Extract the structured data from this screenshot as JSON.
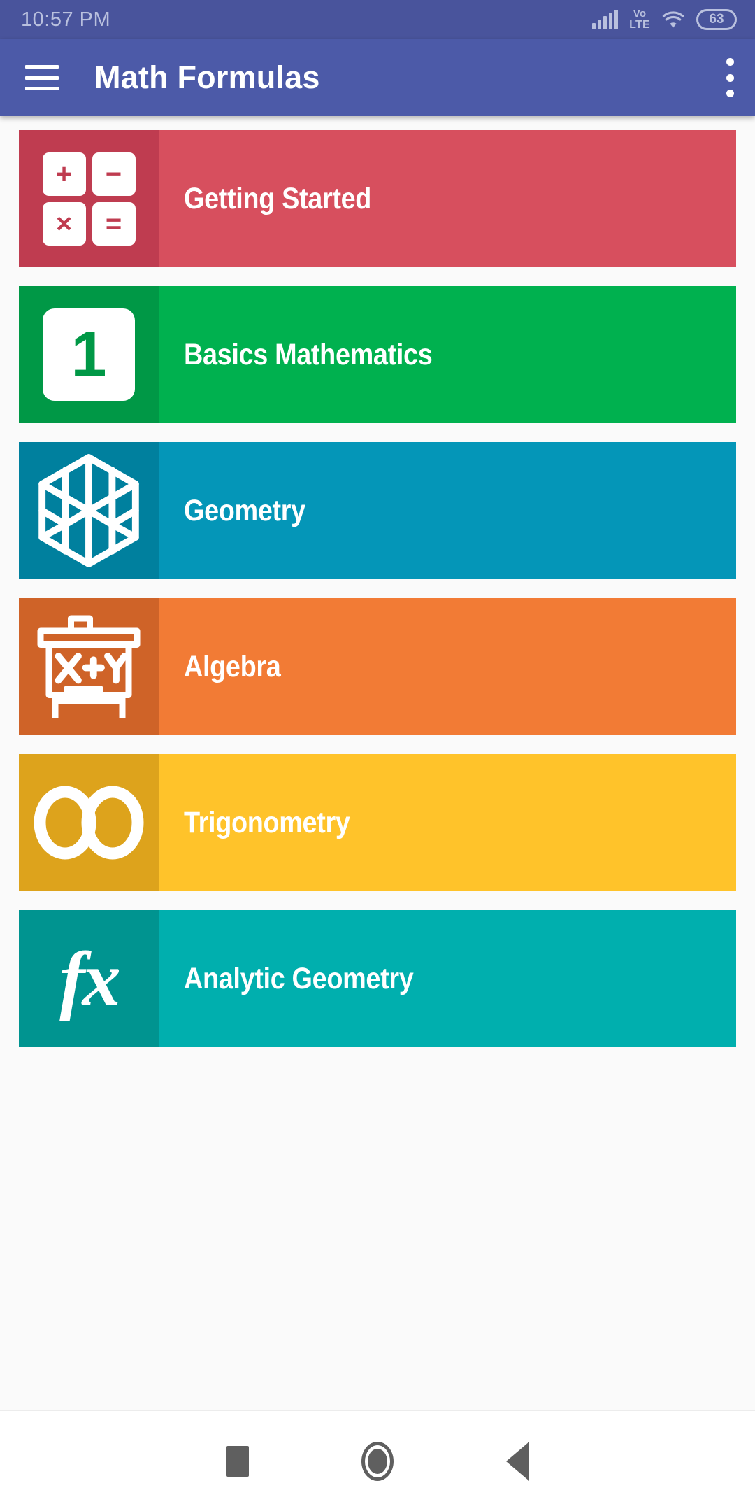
{
  "status_bar": {
    "time": "10:57 PM",
    "signal_icon": "signal-bars-icon",
    "volte_top": "Vo",
    "volte_bottom": "LTE",
    "wifi_icon": "wifi-icon",
    "battery_level": "63",
    "background_color": "#49549c",
    "foreground_color": "#b9c0de"
  },
  "app_bar": {
    "menu_icon": "hamburger-menu-icon",
    "title": "Math Formulas",
    "overflow_icon": "overflow-menu-icon",
    "background_color": "#4c5aa8",
    "title_color": "#ffffff"
  },
  "list": {
    "items": [
      {
        "label": "Getting Started",
        "icon": "calculator-icon",
        "icon_panel_color": "#bf3c50",
        "body_color": "#d74f5e",
        "glyphs": [
          "+",
          "−",
          "×",
          "="
        ]
      },
      {
        "label": "Basics Mathematics",
        "icon": "number-one-tile-icon",
        "icon_panel_color": "#009846",
        "body_color": "#00b14f",
        "glyphs": [
          "1"
        ]
      },
      {
        "label": "Geometry",
        "icon": "cube-icon",
        "icon_panel_color": "#00809e",
        "body_color": "#0496b8",
        "glyphs": []
      },
      {
        "label": "Algebra",
        "icon": "whiteboard-xy-icon",
        "icon_panel_color": "#cf6328",
        "body_color": "#f27b35",
        "glyphs": [
          "X+Y"
        ]
      },
      {
        "label": "Trigonometry",
        "icon": "infinity-icon",
        "icon_panel_color": "#dda31c",
        "body_color": "#ffc32a",
        "glyphs": []
      },
      {
        "label": "Analytic Geometry",
        "icon": "fx-function-icon",
        "icon_panel_color": "#009490",
        "body_color": "#00afae",
        "glyphs": [
          "fx"
        ]
      }
    ]
  },
  "nav_bar": {
    "recents_icon": "recents-square-icon",
    "home_icon": "home-circle-icon",
    "back_icon": "back-triangle-icon",
    "background_color": "#ffffff",
    "icon_color": "#5f5f5f"
  }
}
